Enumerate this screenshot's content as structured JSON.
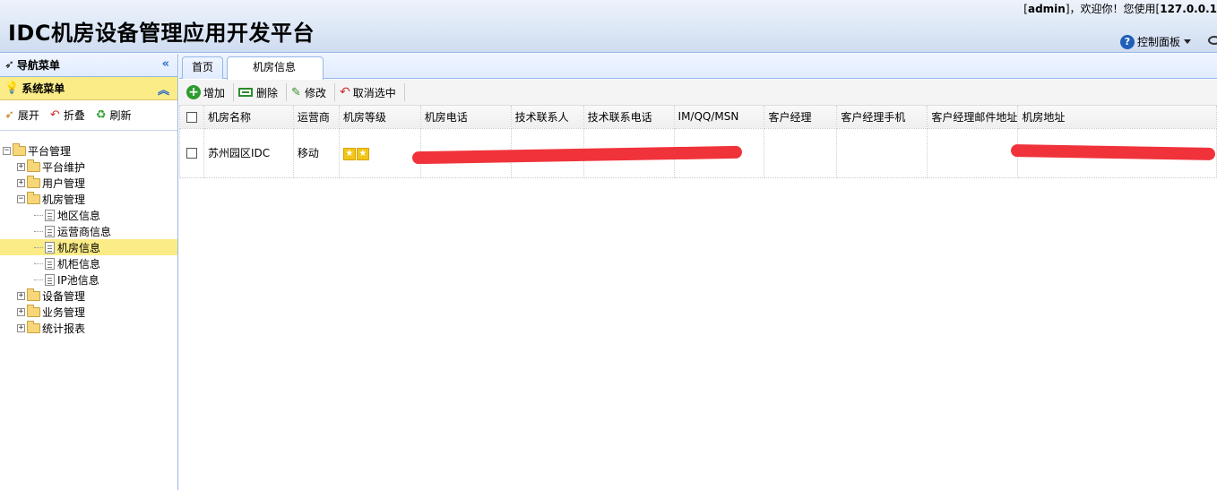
{
  "header": {
    "title": "IDC机房设备管理应用开发平台",
    "welcome_prefix": "[",
    "user": "admin",
    "welcome_mid": "]，欢迎你！您使用[",
    "ip": "127.0.0.1",
    "control_panel": "控制面板"
  },
  "sidebar": {
    "nav_title": "导航菜单",
    "sys_title": "系统菜单",
    "tools": [
      "展开",
      "折叠",
      "刷新"
    ],
    "tree": {
      "root": "平台管理",
      "groups": [
        {
          "label": "平台维护",
          "expanded": false
        },
        {
          "label": "用户管理",
          "expanded": false
        },
        {
          "label": "机房管理",
          "expanded": true,
          "children": [
            "地区信息",
            "运营商信息",
            "机房信息",
            "机柜信息",
            "IP池信息"
          ],
          "selected_child": "机房信息"
        },
        {
          "label": "设备管理",
          "expanded": false
        },
        {
          "label": "业务管理",
          "expanded": false
        },
        {
          "label": "统计报表",
          "expanded": false
        }
      ]
    }
  },
  "tabs": [
    {
      "label": "首页",
      "active": false
    },
    {
      "label": "机房信息",
      "active": true
    }
  ],
  "toolbar": {
    "add": "增加",
    "delete": "删除",
    "edit": "修改",
    "cancel_select": "取消选中"
  },
  "grid": {
    "columns": [
      "机房名称",
      "运营商",
      "机房等级",
      "机房电话",
      "技术联系人",
      "技术联系电话",
      "IM/QQ/MSN",
      "客户经理",
      "客户经理手机",
      "客户经理邮件地址",
      "机房地址"
    ],
    "rows": [
      {
        "name": "苏州园区IDC",
        "carrier": "移动",
        "level": 2,
        "phone": "",
        "tech_contact": "",
        "tech_phone": "",
        "im": "",
        "manager": "",
        "manager_mobile": "",
        "manager_email": "",
        "address": ""
      }
    ]
  }
}
